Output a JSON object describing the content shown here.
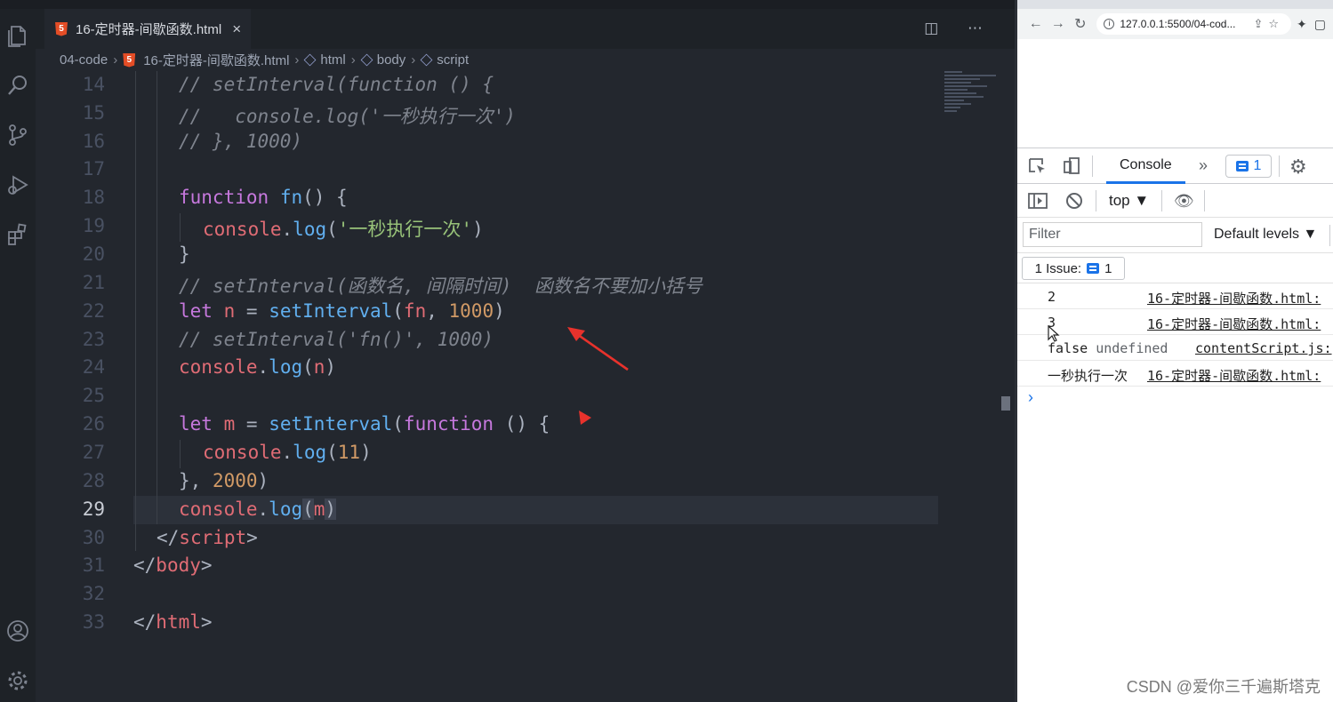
{
  "vscode": {
    "tab": {
      "icon_text": "5",
      "label": "16-定时器-间歇函数.html",
      "close": "×"
    },
    "tab_actions": "◫ ⋯",
    "breadcrumb": [
      "04-code",
      "16-定时器-间歇函数.html",
      "html",
      "body",
      "script"
    ],
    "line_numbers": [
      "14",
      "15",
      "16",
      "17",
      "18",
      "19",
      "20",
      "21",
      "22",
      "23",
      "24",
      "25",
      "26",
      "27",
      "28",
      "29",
      "30",
      "31",
      "32",
      "33"
    ],
    "code": {
      "l14": "// setInterval(function () {",
      "l15": "//   console.log('一秒执行一次')",
      "l16": "// }, 1000)",
      "l18a": "function",
      "l18b": "fn",
      "l18c": "() {",
      "l19a": "console",
      "l19b": "log",
      "l19c": "'一秒执行一次'",
      "l20": "}",
      "l21": "// setInterval(函数名, 间隔时间)  函数名不要加小括号",
      "l22a": "let",
      "l22b": "n",
      "l22c": "setInterval",
      "l22d": "fn",
      "l22e": "1000",
      "l23": "// setInterval('fn()', 1000)",
      "l24a": "console",
      "l24b": "log",
      "l24c": "n",
      "l26a": "let",
      "l26b": "m",
      "l26c": "setInterval",
      "l26d": "function",
      "l26e": "() {",
      "l27a": "console",
      "l27b": "log",
      "l27c": "11",
      "l28a": "},",
      "l28b": "2000",
      "l28c": ")",
      "l29a": "console",
      "l29b": "log",
      "l29c": "m",
      "l30": "script",
      "l31": "body",
      "l33": "html"
    }
  },
  "browser": {
    "url": "127.0.0.1:5500/04-cod...",
    "devtools": {
      "console_tab": "Console",
      "issues_count": "1",
      "context": "top ▼",
      "filter_placeholder": "Filter",
      "levels": "Default levels ▼",
      "issues_button": "1 Issue:",
      "issues_button_count": "1",
      "rows": [
        {
          "value": "2",
          "source": "16-定时器-间歇函数.html:"
        },
        {
          "value": "3",
          "source": "16-定时器-间歇函数.html:"
        },
        {
          "value": "false",
          "value2": "undefined",
          "source": "contentScript.js:"
        },
        {
          "value": "一秒执行一次",
          "source": "16-定时器-间歇函数.html:"
        }
      ]
    }
  },
  "watermark": "CSDN @爱你三千遍斯塔克",
  "colors": {
    "accent": "#1a73e8",
    "annotation": "#e8322c",
    "editor_bg": "#23272e"
  }
}
